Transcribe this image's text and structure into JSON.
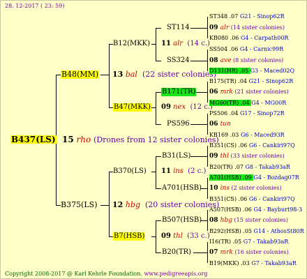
{
  "header": {
    "date": "28. 12-2017 ( 23: 59)"
  },
  "footer": {
    "copyright": "Copyright 2008-2017 @ Karl Kehrle Foundation.",
    "site": "www.pedigreeapis.org"
  },
  "root": {
    "name": "B437(LS)",
    "gen": "15",
    "ident": "rho",
    "note": "(Drones from 12 sister colonies)"
  },
  "sire": {
    "name": "B48(MM)",
    "gen": "13",
    "ident": "bal",
    "note": "(22 sister colonies)"
  },
  "dam": {
    "name": "B375(LS)",
    "gen": "12",
    "ident": "hbg",
    "note": "(20 sister colonies)"
  },
  "g3": {
    "b12": {
      "name": "B12(MKK)",
      "gen": "11",
      "ident": "alr",
      "note": "(14 c.)"
    },
    "b47": {
      "name": "B47(MKK)",
      "gen": "09",
      "ident": "nex",
      "note": "(12 c.)"
    },
    "b370": {
      "name": "B370(LS)",
      "gen": "11",
      "ident": "ins",
      "note": "(2 c.)"
    },
    "b7": {
      "name": "B7(HSB)",
      "gen": "09",
      "ident": "thl",
      "note": "(33 c.)"
    }
  },
  "g4": {
    "st114": "ST114",
    "ss324": "SS324",
    "b171": "B171(TR)",
    "ps596": "PS596",
    "b31": "B31(LS)",
    "a701": "A701(HSB)",
    "b507": "B507(HSB)",
    "b20": "B20(TR)"
  },
  "g5": [
    {
      "name": "ST348",
      "year": ".07",
      "loc": "G21 - Sinop62R"
    },
    {
      "gen": "09",
      "ident": "alr",
      "note": "(14 sister colonies)"
    },
    {
      "name": "KB080",
      "year": ".06",
      "loc": "G4 - Carpath00R"
    },
    {
      "name": "SS504",
      "year": ".06",
      "loc": "G4 - Carnic99R"
    },
    {
      "gen": "08",
      "ident": "ave",
      "note": "(8 sister colonies)"
    },
    {
      "name": "D131(HR)",
      "year": ".05",
      "loc": "G3 - Maced02Q"
    },
    {
      "name": "B175(TR)",
      "year": ".04",
      "loc": "G21 - Sinop62R"
    },
    {
      "gen": "06",
      "ident": "mrk",
      "note": "(21 sister colonies)"
    },
    {
      "name": "MG60(TR)",
      "year": ".04",
      "loc": "G4 - MG00R"
    },
    {
      "name": "PS506",
      "year": ".04",
      "loc": "G17 - Sinop72R"
    },
    {
      "gen": "06",
      "ident": "tun",
      "note": ""
    },
    {
      "name": "KB169",
      "year": ".03",
      "loc": "G6 - Maced93R"
    },
    {
      "name": "B351(CS)",
      "year": ".06",
      "loc": "G6 - Cankiri97Q"
    },
    {
      "gen": "09",
      "ident": "thl",
      "note": "(33 sister colonies)"
    },
    {
      "name": "B20(TR)",
      "year": ".07",
      "loc": "G8 - Takab93aR"
    },
    {
      "name": "A701(HSB)",
      "year": ".09",
      "loc": "G4 - Bozdag07R"
    },
    {
      "gen": "10",
      "ident": "ins",
      "note": "(2 sister colonies)"
    },
    {
      "name": "B351(CS)",
      "year": ".06",
      "loc": "G6 - Cankiri97Q"
    },
    {
      "name": "A507(HSB)",
      "year": ".06",
      "loc": "G4 - Bayburt98-3"
    },
    {
      "gen": "08",
      "ident": "hbg",
      "note": "(15 sister colonies)"
    },
    {
      "name": "B292(HSB)",
      "year": ".05",
      "loc": "G14 - AthosSt80R"
    },
    {
      "name": "I16(TR)",
      "year": ".05",
      "loc": "G7 - Takab93aR"
    },
    {
      "gen": "07",
      "ident": "mrk",
      "note": "(16 sister colonies)"
    },
    {
      "name": "B19(MKK)",
      "year": ".03",
      "loc": "G7 - Takab93aR"
    }
  ]
}
